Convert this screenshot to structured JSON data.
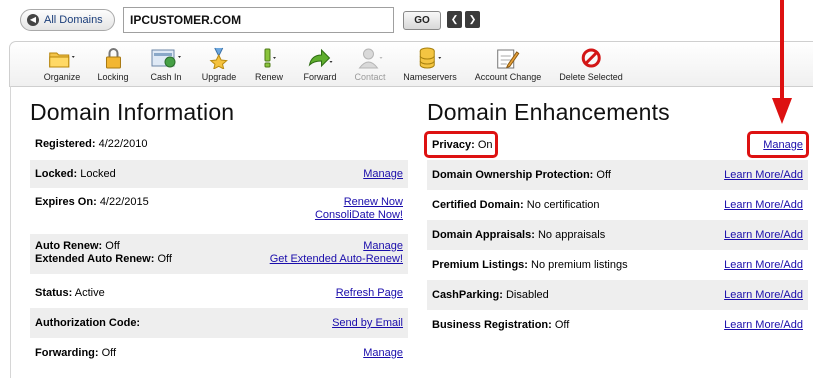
{
  "topbar": {
    "all_domains_label": "All Domains",
    "domain_value": "IPCUSTOMER.COM",
    "go_label": "GO"
  },
  "toolbar": {
    "items": [
      {
        "label": "Organize",
        "icon": "folder-icon",
        "enabled": true
      },
      {
        "label": "Locking",
        "icon": "lock-icon",
        "enabled": true
      },
      {
        "label": "Cash In",
        "icon": "cash-in-icon",
        "enabled": true
      },
      {
        "label": "Upgrade",
        "icon": "upgrade-medal-icon",
        "enabled": true
      },
      {
        "label": "Renew",
        "icon": "renew-exclamation-icon",
        "enabled": true
      },
      {
        "label": "Forward",
        "icon": "forward-arrow-icon",
        "enabled": true
      },
      {
        "label": "Contact",
        "icon": "contact-person-icon",
        "enabled": false
      },
      {
        "label": "Nameservers",
        "icon": "nameservers-icon",
        "enabled": true
      },
      {
        "label": "Account Change",
        "icon": "account-change-icon",
        "enabled": true
      },
      {
        "label": "Delete Selected",
        "icon": "delete-icon",
        "enabled": true
      }
    ]
  },
  "domain_information": {
    "title": "Domain Information",
    "registered_label": "Registered:",
    "registered_value": "4/22/2010",
    "locked_label": "Locked:",
    "locked_value": "Locked",
    "locked_link": "Manage",
    "expires_label": "Expires On:",
    "expires_value": "4/22/2015",
    "renew_link": "Renew Now",
    "consolidate_link": "ConsoliDate Now!",
    "auto_renew_label": "Auto Renew:",
    "auto_renew_value": "Off",
    "extended_label": "Extended Auto Renew:",
    "extended_value": "Off",
    "auto_renew_link": "Manage",
    "extended_link": "Get Extended Auto-Renew!",
    "status_label": "Status:",
    "status_value": "Active",
    "status_link": "Refresh Page",
    "auth_label": "Authorization Code:",
    "auth_link": "Send by Email",
    "forwarding_label": "Forwarding:",
    "forwarding_value": "Off",
    "forwarding_link": "Manage"
  },
  "domain_enhancements": {
    "title": "Domain Enhancements",
    "privacy_label": "Privacy:",
    "privacy_value": "On",
    "privacy_link": "Manage",
    "ownership_label": "Domain Ownership Protection:",
    "ownership_value": "Off",
    "ownership_link": "Learn More/Add",
    "certified_label": "Certified Domain:",
    "certified_value": "No certification",
    "certified_link": "Learn More/Add",
    "appraisals_label": "Domain Appraisals:",
    "appraisals_value": "No appraisals",
    "appraisals_link": "Learn More/Add",
    "premium_label": "Premium Listings:",
    "premium_value": "No premium listings",
    "premium_link": "Learn More/Add",
    "cashparking_label": "CashParking:",
    "cashparking_value": "Disabled",
    "cashparking_link": "Learn More/Add",
    "business_label": "Business Registration:",
    "business_value": "Off",
    "business_link": "Learn More/Add"
  },
  "colors": {
    "highlight_red": "#dd1111",
    "link_blue": "#1a0dab",
    "row_shade": "#eeeeee"
  }
}
